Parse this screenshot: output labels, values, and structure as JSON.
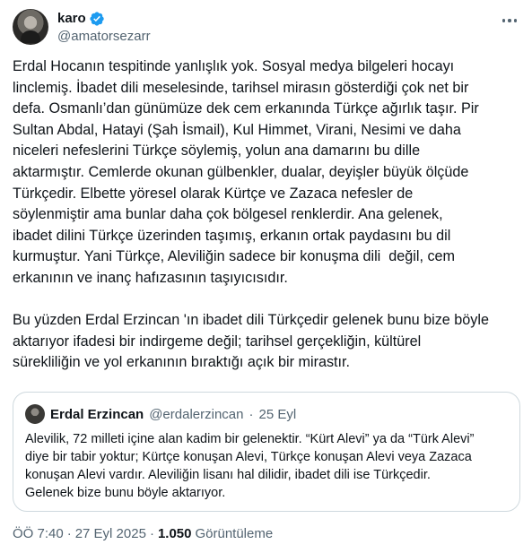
{
  "author": {
    "display_name": "karo",
    "handle": "@amatorsezarr",
    "verified_color": "#1d9bf0"
  },
  "tweet": {
    "text": "Erdal Hocanın tespitinde yanlışlık yok. Sosyal medya bilgeleri hocayı\nlinclemiş. İbadet dili meselesinde, tarihsel mirasın gösterdiği çok net bir\ndefa. Osmanlı’dan günümüze dek cem erkanında Türkçe ağırlık taşır. Pir\nSultan Abdal, Hatayi (Şah İsmail), Kul Himmet, Virani, Nesimi ve daha\nniceleri nefeslerini Türkçe söylemiş, yolun ana damarını bu dille\naktarmıştır. Cemlerde okunan gülbenkler, dualar, deyişler büyük ölçüde\nTürkçedir. Elbette yöresel olarak Kürtçe ve Zazaca nefesler de\nsöylenmiştir ama bunlar daha çok bölgesel renklerdir. Ana gelenek,\nibadet dilini Türkçe üzerinden taşımış, erkanın ortak paydasını bu dil\nkurmuştur. Yani Türkçe, Aleviliğin sadece bir konuşma dili  değil, cem\nerkanının ve inanç hafızasının taşıyıcısıdır.\n\nBu yüzden Erdal Erzincan 'ın ibadet dili Türkçedir gelenek bunu bize böyle\naktarıyor ifadesi bir indirgeme değil; tarihsel gerçekliğin, kültürel\nsürekliliğin ve yol erkanının bıraktığı açık bir mirastır."
  },
  "quote": {
    "display_name": "Erdal Erzincan",
    "handle": "@erdalerzincan",
    "dot": "·",
    "date": "25 Eyl",
    "text": "Alevilik, 72 milleti içine alan kadim bir gelenektir. “Kürt Alevi” ya da “Türk Alevi”\ndiye bir tabir yoktur; Kürtçe konuşan Alevi, Türkçe konuşan Alevi veya Zazaca\nkonuşan Alevi vardır. Aleviliğin lisanı hal dilidir, ibadet dili ise Türkçedir.\nGelenek bize bunu böyle aktarıyor."
  },
  "meta": {
    "time": "ÖÖ 7:40",
    "dot": "·",
    "date": "27 Eyl 2025",
    "views_count": "1.050",
    "views_label": "Görüntüleme"
  }
}
